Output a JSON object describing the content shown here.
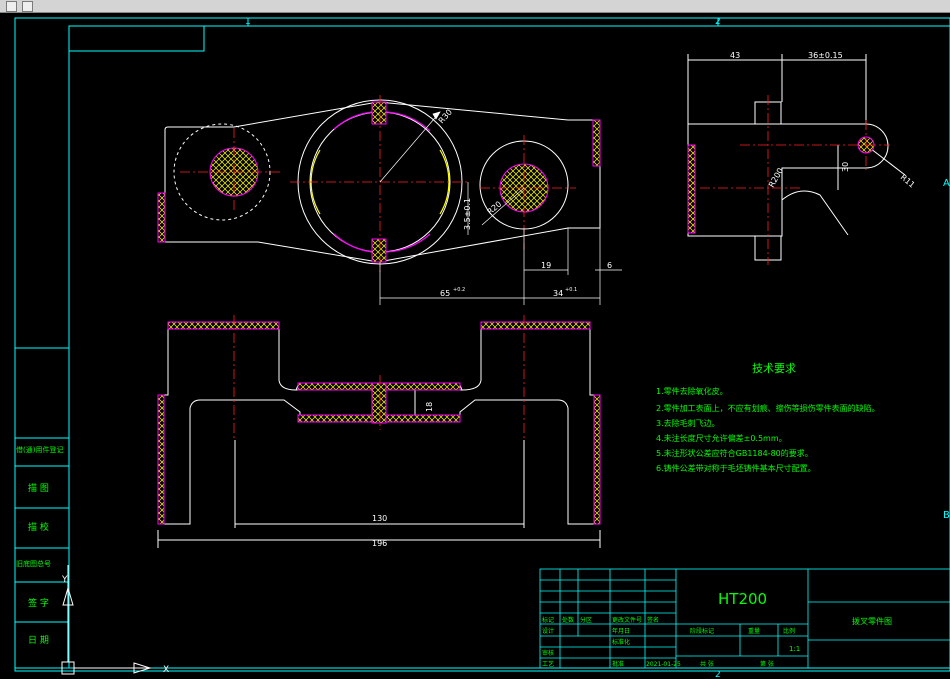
{
  "zones": {
    "top": [
      "1",
      "2"
    ],
    "bottom": [
      "1",
      "2"
    ],
    "right": [
      "A",
      "B"
    ]
  },
  "dims": {
    "d_top_43": "43",
    "d_top_36": "36±0.15",
    "d_r30": "R30",
    "d_r20": "R20",
    "d_r11": "R11",
    "d_r200": "R200",
    "d_30": "30",
    "d_35": "3.5±0.1",
    "d_19": "19",
    "d_6": "6",
    "d_65": "65",
    "d_65_tol": "+0.2",
    "d_34": "34",
    "d_34_tol": "+0.1",
    "d_18": "18",
    "d_130": "130",
    "d_196": "196"
  },
  "notes": {
    "title": "技术要求",
    "items": [
      "1.零件去除氧化皮。",
      "2.零件加工表面上，不应有划痕、擦伤等损伤零件表面的缺陷。",
      "3.去除毛刺飞边。",
      "4.未注长度尺寸允许偏差±0.5mm。",
      "5.未注形状公差应符合GB1184-80的要求。",
      "6.铸件公差带对称于毛坯铸件基本尺寸配置。"
    ]
  },
  "title_block": {
    "material": "HT200",
    "drawing_name": "拨叉零件图",
    "scale": "1:1",
    "date": "2021-01-25",
    "labels": {
      "mark": "标记",
      "count": "处数",
      "zone": "分区",
      "doc": "更改文件号",
      "sign": "签名",
      "ymd": "年月日",
      "design": "设计",
      "std": "标准化",
      "review": "审核",
      "process": "工艺",
      "approve": "批准",
      "stage_mark": "阶段标记",
      "weight": "重量",
      "ratio": "比例",
      "sheet": "共 张",
      "sheet2": "第 张"
    }
  },
  "side_block": [
    "借(通)用件登记",
    "描 图",
    "描 校",
    "旧底图总号",
    "签 字",
    "日 期"
  ],
  "colors": {
    "line": "#ffffff",
    "frame": "#00ffff",
    "center": "#ff2020",
    "hatch": "#ffff00",
    "section": "#ff00ff",
    "dim": "#ffffff",
    "notes": "#00ff00",
    "material": "#00ff00"
  }
}
